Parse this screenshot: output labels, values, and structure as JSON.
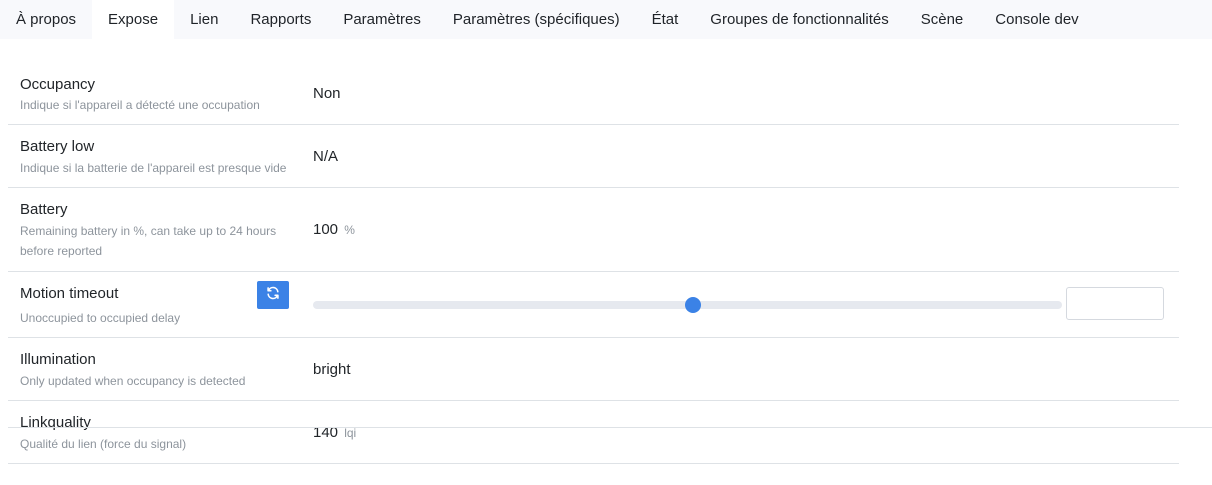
{
  "tabs": [
    {
      "label": "À propos",
      "active": false
    },
    {
      "label": "Expose",
      "active": true
    },
    {
      "label": "Lien",
      "active": false
    },
    {
      "label": "Rapports",
      "active": false
    },
    {
      "label": "Paramètres",
      "active": false
    },
    {
      "label": "Paramètres (spécifiques)",
      "active": false
    },
    {
      "label": "État",
      "active": false
    },
    {
      "label": "Groupes de fonctionnalités",
      "active": false
    },
    {
      "label": "Scène",
      "active": false
    },
    {
      "label": "Console dev",
      "active": false
    }
  ],
  "features": {
    "occupancy": {
      "name": "Occupancy",
      "description": "Indique si l'appareil a détecté une occupation",
      "value": "Non"
    },
    "battery_low": {
      "name": "Battery low",
      "description": "Indique si la batterie de l'appareil est presque vide",
      "value": "N/A"
    },
    "battery": {
      "name": "Battery",
      "description": "Remaining battery in %, can take up to 24 hours before reported",
      "value": "100",
      "unit": "%"
    },
    "motion_timeout": {
      "name": "Motion timeout",
      "description": "Unoccupied to occupied delay",
      "slider_fraction": 0.507,
      "input_value": ""
    },
    "illumination": {
      "name": "Illumination",
      "description": "Only updated when occupancy is detected",
      "value": "bright"
    },
    "linkquality": {
      "name": "Linkquality",
      "description": "Qualité du lien (force du signal)",
      "value": "140",
      "unit": "lqi"
    }
  },
  "icons": {
    "refresh": "refresh-icon"
  },
  "colors": {
    "accent": "#3b82e6"
  }
}
